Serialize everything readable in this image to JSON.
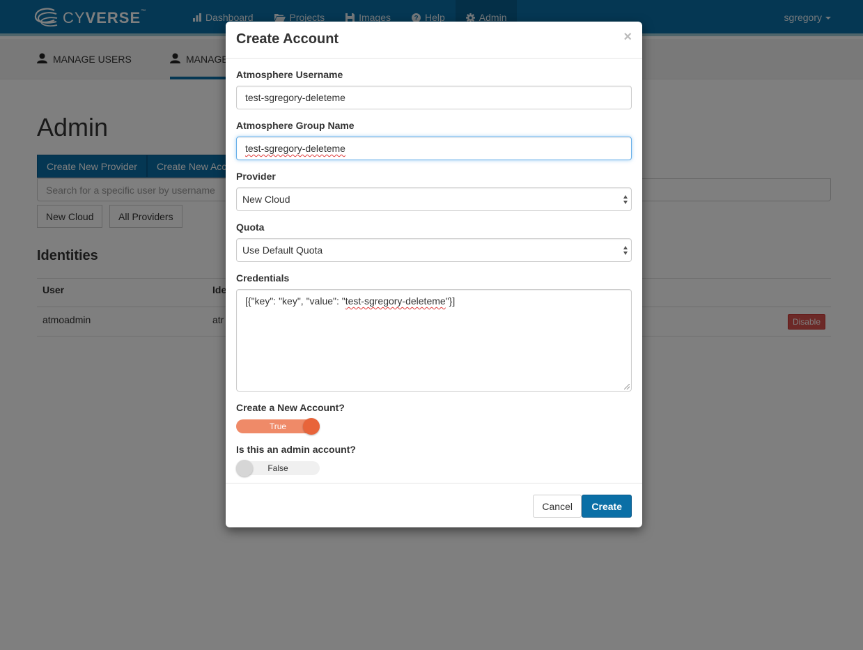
{
  "navbar": {
    "brand": {
      "prefix": "CY",
      "bold": "VERSE",
      "tm": "™"
    },
    "items": [
      {
        "label": "Dashboard",
        "icon": "bar-chart-icon"
      },
      {
        "label": "Projects",
        "icon": "folder-open-icon"
      },
      {
        "label": "Images",
        "icon": "floppy-disk-icon"
      },
      {
        "label": "Help",
        "icon": "question-circle-icon"
      },
      {
        "label": "Admin",
        "icon": "gear-icon",
        "active": true
      }
    ],
    "user": "sgregory"
  },
  "subnav": {
    "tabs": [
      {
        "label": "MANAGE USERS",
        "icon": "user-icon"
      },
      {
        "label": "MANAGE",
        "icon": "user-icon",
        "active": true
      }
    ]
  },
  "main": {
    "title": "Admin",
    "buttons": [
      "Create New Provider",
      "Create New Acco"
    ],
    "search_placeholder": "Search for a specific user by username",
    "filters": [
      "New Cloud",
      "All Providers"
    ],
    "section_title": "Identities",
    "table": {
      "headers": [
        "User",
        "Ide"
      ],
      "rows": [
        {
          "user": "atmoadmin",
          "identity": "atr",
          "action": "Disable"
        }
      ]
    }
  },
  "modal": {
    "title": "Create Account",
    "close": "×",
    "fields": {
      "username": {
        "label": "Atmosphere Username",
        "value": "test-sgregory-deleteme"
      },
      "group": {
        "label": "Atmosphere Group Name",
        "value": "test-sgregory-deleteme"
      },
      "provider": {
        "label": "Provider",
        "value": "New Cloud"
      },
      "quota": {
        "label": "Quota",
        "value": "Use Default Quota"
      },
      "credentials": {
        "label": "Credentials",
        "prefix": "[{\"key\": \"key\", \"value\": \"",
        "highlight": "test-sgregory-deleteme",
        "suffix": "\"}]"
      }
    },
    "toggles": {
      "new_account": {
        "label": "Create a New Account?",
        "state": "True"
      },
      "admin": {
        "label": "Is this an admin account?",
        "state": "False"
      }
    },
    "footer": {
      "cancel": "Cancel",
      "create": "Create"
    }
  },
  "colors": {
    "brand_blue": "#0a6fa6",
    "toggle_on": "#ef8a68",
    "toggle_knob_on": "#e8643a",
    "danger": "#d9534f"
  }
}
